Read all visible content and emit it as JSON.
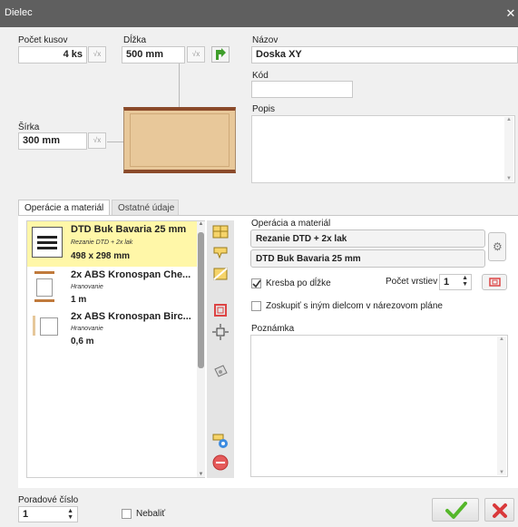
{
  "window": {
    "title": "Dielec",
    "close_glyph": "✕"
  },
  "fields": {
    "pocet_kusov_label": "Počet kusov",
    "pocet_kusov_value": "4 ks",
    "dlzka_label": "Dĺžka",
    "dlzka_value": "500 mm",
    "sirka_label": "Šírka",
    "sirka_value": "300 mm",
    "sqrt_glyph": "√x",
    "nazov_label": "Názov",
    "nazov_value": "Doska XY",
    "kod_label": "Kód",
    "kod_value": "",
    "popis_label": "Popis",
    "popis_value": ""
  },
  "tabs": [
    {
      "label": "Operácie a materiál",
      "active": true
    },
    {
      "label": "Ostatné údaje",
      "active": false
    }
  ],
  "operations": [
    {
      "title": "DTD Buk Bavaria 25 mm",
      "subtitle": "Rezanie DTD + 2x lak",
      "value": "498 x 298 mm",
      "selected": true
    },
    {
      "title": "2x ABS Kronospan Che...",
      "subtitle": "Hranovanie",
      "value": "1 m",
      "selected": false
    },
    {
      "title": "2x ABS Kronospan Birc...",
      "subtitle": "Hranovanie",
      "value": "0,6 m",
      "selected": false
    }
  ],
  "right_panel": {
    "operacia_label": "Operácia a materiál",
    "operation_select": "Rezanie DTD + 2x lak",
    "material_select": "DTD Buk Bavaria 25 mm",
    "kresba_label": "Kresba po dĺžke",
    "kresba_checked": true,
    "pocet_vrstiev_label": "Počet vrstiev",
    "pocet_vrstiev_value": "1",
    "zoskupit_label": "Zoskupiť s iným dielcom v nárezovom pláne",
    "zoskupit_checked": false,
    "poznamka_label": "Poznámka",
    "poznamka_value": ""
  },
  "footer": {
    "poradove_label": "Poradové číslo",
    "poradove_value": "1",
    "nebalit_label": "Nebaliť",
    "nebalit_checked": false
  },
  "colors": {
    "titlebar": "#5f5f5f",
    "selected_item": "#fff7a8",
    "ok_green": "#55b72a",
    "cancel_red": "#d9393b",
    "wood_edge": "#8b4a2a",
    "wood_face": "#e8c89a"
  }
}
